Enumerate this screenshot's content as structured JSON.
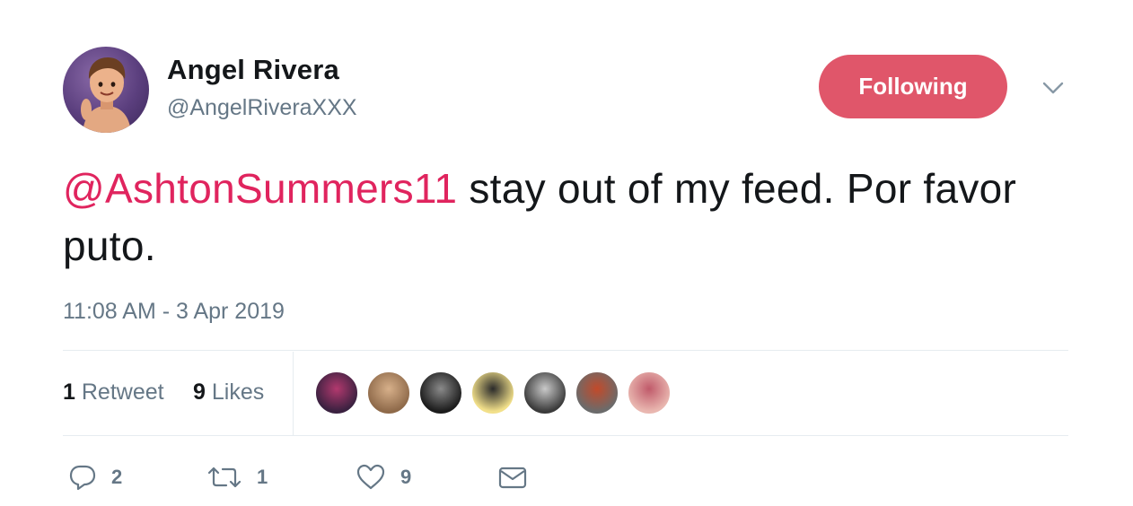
{
  "author": {
    "display_name": "Angel Rivera",
    "handle": "@AngelRiveraXXX"
  },
  "follow_button": {
    "label": "Following",
    "color": "#e0566a"
  },
  "tweet": {
    "mention": "@AshtonSummers11",
    "text": " stay out of my feed. Por favor puto.",
    "timestamp": "11:08 AM - 3 Apr 2019"
  },
  "stats": {
    "retweets_count": "1",
    "retweets_label": "Retweet",
    "likes_count": "9",
    "likes_label": "Likes"
  },
  "liker_avatars": [
    {
      "name": "liker-1",
      "colors": [
        "#3a2140",
        "#b2396e"
      ]
    },
    {
      "name": "liker-2",
      "colors": [
        "#8f6a4a",
        "#d7b08a"
      ]
    },
    {
      "name": "liker-3",
      "colors": [
        "#1c1c1c",
        "#8a8a8a"
      ]
    },
    {
      "name": "liker-4",
      "colors": [
        "#f2e08a",
        "#2a2a2a"
      ]
    },
    {
      "name": "liker-5",
      "colors": [
        "#3b3b3b",
        "#c9c9c9"
      ]
    },
    {
      "name": "liker-6",
      "colors": [
        "#6b6b6b",
        "#c24a2a"
      ]
    },
    {
      "name": "liker-7",
      "colors": [
        "#e9b7b0",
        "#c05a6a"
      ]
    }
  ],
  "actions": {
    "reply_count": "2",
    "retweet_count": "1",
    "like_count": "9"
  },
  "colors": {
    "mention": "#e0245e",
    "secondary_text": "#657786",
    "primary_text": "#14171a",
    "divider": "#e6ecf0"
  }
}
